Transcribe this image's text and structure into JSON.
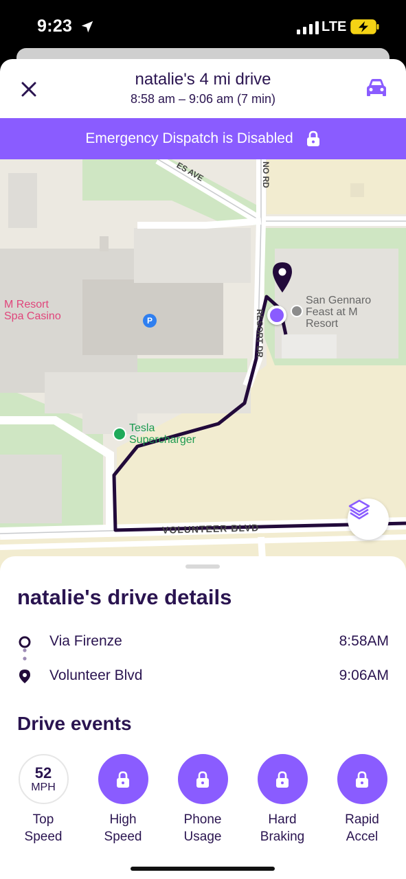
{
  "status_bar": {
    "time": "9:23",
    "network": "LTE"
  },
  "header": {
    "title": "natalie's 4 mi drive",
    "time_range": "8:58 am – 9:06 am (7 min)"
  },
  "banner": {
    "text": "Emergency Dispatch is Disabled"
  },
  "map": {
    "labels": {
      "resort": "M Resort\nSpa Casino",
      "gennaro": "San Gennaro\nFeast at M\nResort",
      "tesla": "Tesla\nSupercharger",
      "volunteer": "VOLUNTEER BLVD",
      "resort_dr": "RESORT DR",
      "ave": "ES AVE",
      "no_rd": "NO RD",
      "parking": "P"
    }
  },
  "details": {
    "title": "natalie's drive details",
    "stops": [
      {
        "name": "Via Firenze",
        "time": "8:58AM"
      },
      {
        "name": "Volunteer Blvd",
        "time": "9:06AM"
      }
    ]
  },
  "events": {
    "title": "Drive events",
    "top_speed": {
      "value": "52",
      "unit": "MPH",
      "label": "Top\nSpeed"
    },
    "items": [
      {
        "label": "High\nSpeed"
      },
      {
        "label": "Phone\nUsage"
      },
      {
        "label": "Hard\nBraking"
      },
      {
        "label": "Rapid\nAccel"
      }
    ]
  },
  "colors": {
    "accent": "#8a5cff",
    "text": "#2a1450",
    "route": "#220a3a"
  }
}
